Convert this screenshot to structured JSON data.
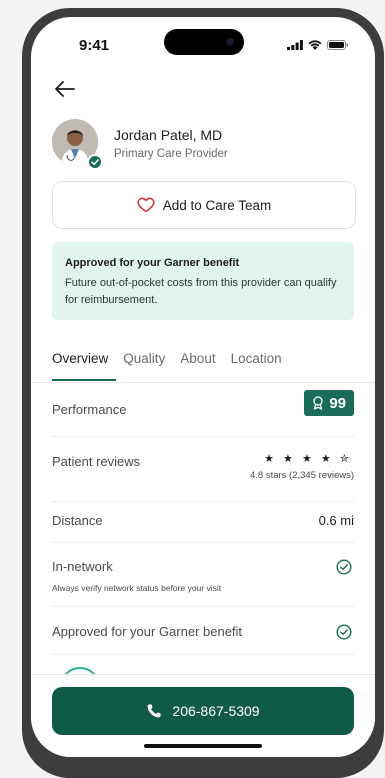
{
  "status_bar": {
    "time": "9:41"
  },
  "provider": {
    "name": "Jordan Patel, MD",
    "role": "Primary Care Provider"
  },
  "care_team_button": {
    "label": "Add to Care Team"
  },
  "benefit_notice": {
    "title": "Approved for your Garner benefit",
    "description": "Future out-of-pocket costs from this provider can qualify for reimbursement."
  },
  "tabs": [
    {
      "label": "Overview",
      "active": true
    },
    {
      "label": "Quality",
      "active": false
    },
    {
      "label": "About",
      "active": false
    },
    {
      "label": "Location",
      "active": false
    }
  ],
  "overview": {
    "performance": {
      "label": "Performance",
      "score": "99"
    },
    "reviews": {
      "label": "Patient reviews",
      "rating": 4.8,
      "stars_text": "★ ★ ★ ★ ✮",
      "summary": "4.8 stars (2,345 reviews)"
    },
    "distance": {
      "label": "Distance",
      "value": "0.6 mi"
    },
    "in_network": {
      "label": "In-network",
      "note": "Always verify network status before your visit"
    },
    "approved": {
      "label": "Approved for your Garner benefit"
    }
  },
  "call_button": {
    "label": "206-867-5309"
  },
  "colors": {
    "brand_green": "#115a47",
    "accent_teal": "#1a6b57",
    "notice_bg": "#e1f4f0",
    "heart": "#d33a3a"
  }
}
